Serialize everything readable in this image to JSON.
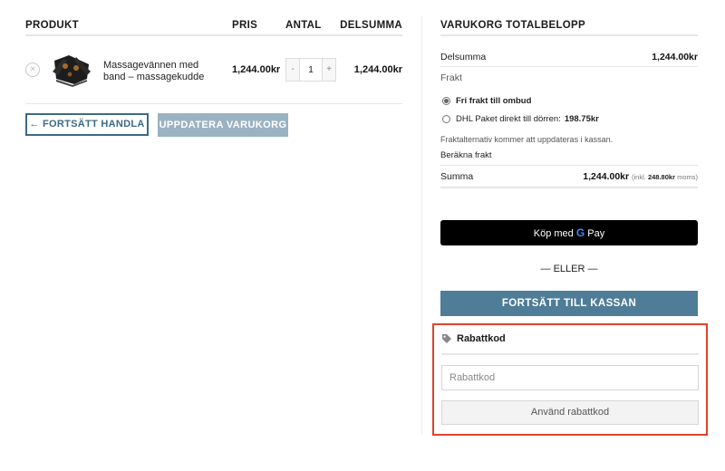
{
  "cart": {
    "headers": {
      "product": "PRODUKT",
      "price": "PRIS",
      "quantity": "ANTAL",
      "subtotal": "DELSUMMA"
    },
    "items": [
      {
        "name": "Massagevännen med band – massagekudde",
        "price": "1,244.00kr",
        "quantity": "1",
        "subtotal": "1,244.00kr",
        "remove_icon": "×",
        "qty_minus": "-",
        "qty_plus": "+"
      }
    ],
    "continue_label": "← FORTSÄTT HANDLA",
    "update_label": "UPPDATERA VARUKORG"
  },
  "totals": {
    "title": "VARUKORG TOTALBELOPP",
    "subtotal_label": "Delsumma",
    "subtotal_value": "1,244.00kr",
    "shipping_label": "Frakt",
    "shipping_options": [
      {
        "label": "Fri frakt till ombud",
        "price": "",
        "selected": true
      },
      {
        "label": "DHL Paket direkt till dörren:",
        "price": "198.75kr",
        "selected": false
      }
    ],
    "shipping_note": "Fraktalternativ kommer att uppdateras i kassan.",
    "calc_shipping": "Beräkna frakt",
    "total_label": "Summa",
    "total_value": "1,244.00kr",
    "total_tax_prefix": "(inkl.",
    "total_tax_value": "248.80kr",
    "total_tax_suffix": "moms)"
  },
  "payment": {
    "gpay_prefix": "Köp med",
    "gpay_brand": "Pay",
    "or_label": "— ELLER —",
    "checkout_label": "FORTSÄTT TILL KASSAN"
  },
  "coupon": {
    "title": "Rabattkod",
    "placeholder": "Rabattkod",
    "apply_label": "Använd rabattkod",
    "tag_icon": "tag-icon"
  },
  "colors": {
    "accent": "#4f7c96",
    "update_button": "#9ab2c2",
    "highlight": "#e0432b",
    "gpay_bg": "#000000"
  }
}
